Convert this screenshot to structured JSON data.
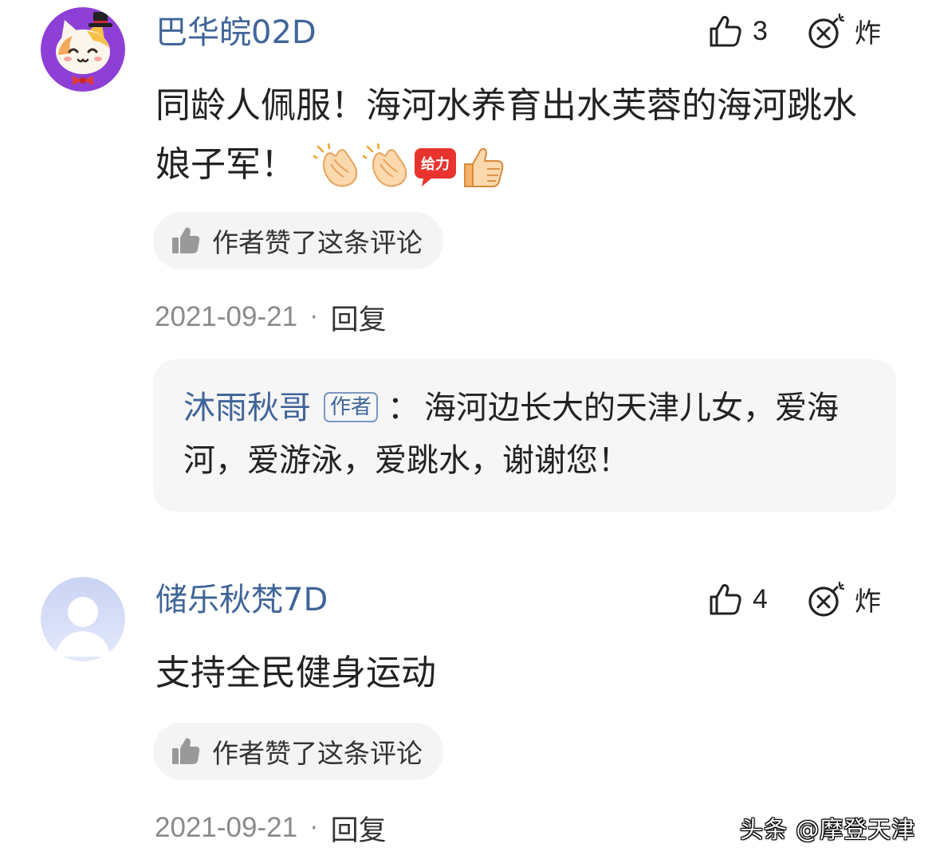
{
  "comments": [
    {
      "username": "巴华皖02D",
      "like_count": "3",
      "bomb_label": "炸",
      "text": "同龄人佩服！海河水养育出水芙蓉的海河跳水娘子军！",
      "emoji": [
        "clap-emoji",
        "clap-emoji",
        "geili-emoji",
        "thumbs-up-emoji"
      ],
      "geili_text": "给力",
      "author_liked": "作者赞了这条评论",
      "date": "2021-09-21",
      "dot": "·",
      "reply_label": "回复",
      "reply": {
        "name": "沐雨秋哥",
        "badge": "作者",
        "separator": "：",
        "text": "海河边长大的天津儿女，爱海河，爱游泳，爱跳水，谢谢您！"
      }
    },
    {
      "username": "储乐秋梵7D",
      "like_count": "4",
      "bomb_label": "炸",
      "text": "支持全民健身运动",
      "author_liked": "作者赞了这条评论",
      "date": "2021-09-21",
      "dot": "·",
      "reply_label": "回复"
    }
  ],
  "watermark": "头条 @摩登天津",
  "colors": {
    "username": "#406599",
    "text": "#222222",
    "meta": "#888888",
    "chip_bg": "#f4f4f4",
    "reply_bg": "#f6f6f6"
  },
  "icons": [
    "thumbs-up-outline-icon",
    "bomb-icon",
    "thumbs-up-filled-icon",
    "cat-avatar",
    "default-user-avatar"
  ]
}
